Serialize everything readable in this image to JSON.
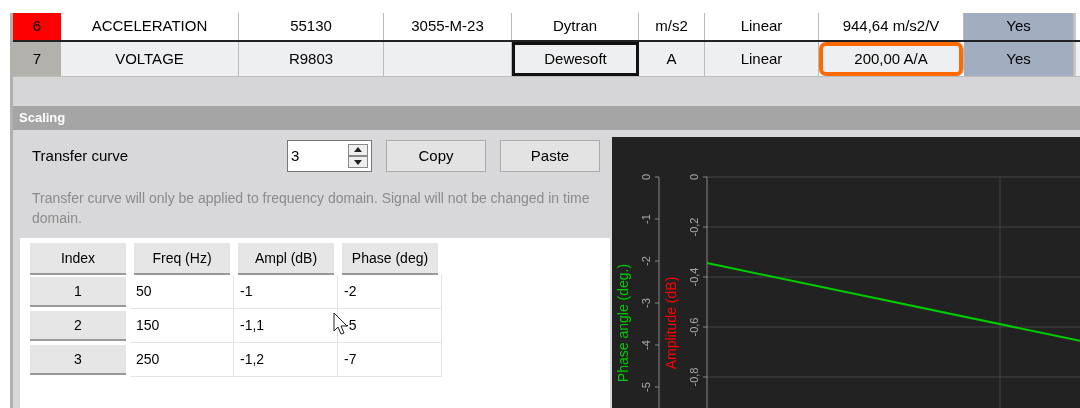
{
  "grid": {
    "rows": [
      {
        "index": "6",
        "color": "#ff0000",
        "selected": false,
        "cells": [
          {
            "text": "ACCELERATION",
            "focused": false,
            "highlighted": false
          },
          {
            "text": "55130",
            "focused": false,
            "highlighted": false
          },
          {
            "text": "3055-M-23",
            "focused": false,
            "highlighted": false
          },
          {
            "text": "Dytran",
            "focused": false,
            "highlighted": false
          },
          {
            "text": "m/s2",
            "focused": false,
            "highlighted": false
          },
          {
            "text": "Linear",
            "focused": false,
            "highlighted": false
          },
          {
            "text": "944,64 m/s2/V",
            "focused": false,
            "highlighted": false
          },
          {
            "text": "Yes",
            "focused": false,
            "highlighted": false
          }
        ]
      },
      {
        "index": "7",
        "color": "#b3b1ac",
        "selected": true,
        "cells": [
          {
            "text": "VOLTAGE",
            "focused": false,
            "highlighted": false
          },
          {
            "text": "R9803",
            "focused": false,
            "highlighted": false
          },
          {
            "text": "",
            "focused": false,
            "highlighted": false
          },
          {
            "text": "Dewesoft",
            "focused": true,
            "highlighted": false
          },
          {
            "text": "A",
            "focused": false,
            "highlighted": false
          },
          {
            "text": "Linear",
            "focused": false,
            "highlighted": false
          },
          {
            "text": "200,00 A/A",
            "focused": false,
            "highlighted": true
          },
          {
            "text": "Yes",
            "focused": false,
            "highlighted": false
          }
        ]
      }
    ]
  },
  "scaling": {
    "title": "Scaling",
    "transfer_curve": {
      "label": "Transfer curve",
      "value": "3"
    },
    "buttons": [
      "Copy",
      "Paste"
    ],
    "hint": "Transfer curve will only be applied to frequency domain. Signal will not be changed in time domain.",
    "table": {
      "columns": [
        "Index",
        "Freq (Hz)",
        "Ampl (dB)",
        "Phase (deg)"
      ],
      "rows": [
        {
          "index": "1",
          "cells": [
            "50",
            "-1",
            "-2"
          ]
        },
        {
          "index": "2",
          "cells": [
            "150",
            "-1,1",
            "-5"
          ]
        },
        {
          "index": "3",
          "cells": [
            "250",
            "-1,2",
            "-7"
          ]
        }
      ]
    },
    "amplitude_axis": {
      "label": "Amplitude (dB)",
      "ticks": [
        "0",
        "-0,2",
        "-0,4",
        "-0,6",
        "-0,8"
      ]
    },
    "phase_axis": {
      "label": "Phase angle (deg.)",
      "ticks": [
        "0",
        "-1",
        "-2",
        "-3",
        "-4",
        "-5"
      ]
    }
  }
}
